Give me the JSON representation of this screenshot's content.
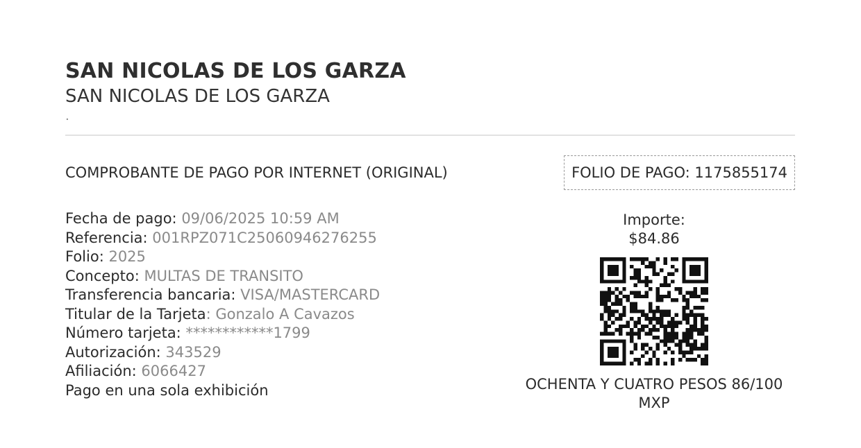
{
  "header": {
    "title": "SAN NICOLAS DE LOS GARZA",
    "subtitle": "SAN NICOLAS DE LOS GARZA",
    "dot": "."
  },
  "receipt": {
    "title": "COMPROBANTE DE PAGO POR INTERNET (ORIGINAL)",
    "folio_label": "FOLIO DE PAGO: ",
    "folio_value": "1175855174"
  },
  "details": [
    {
      "label": "Fecha de pago: ",
      "value": "09/06/2025 10:59 AM"
    },
    {
      "label": "Referencia: ",
      "value": "001RPZ071C25060946276255"
    },
    {
      "label": "Folio: ",
      "value": "2025"
    },
    {
      "label": "Concepto: ",
      "value": "MULTAS DE TRANSITO"
    },
    {
      "label": "Transferencia bancaria: ",
      "value": "VISA/MASTERCARD"
    },
    {
      "label": "Titular de la Tarjeta",
      "value": ": Gonzalo A Cavazos"
    },
    {
      "label": "Número tarjeta: ",
      "value": "************1799"
    },
    {
      "label": "Autorización: ",
      "value": "343529"
    },
    {
      "label": "Afiliación: ",
      "value": "6066427"
    },
    {
      "label": "Pago en una sola exhibición",
      "value": ""
    }
  ],
  "amount": {
    "label": "Importe:",
    "value": "$84.86",
    "words_line1": "OCHENTA Y CUATRO PESOS 86/100",
    "words_line2": "MXP"
  },
  "colors": {
    "text": "#2b2b2b",
    "value": "#8a8a8a",
    "divider": "#e2e2e2"
  },
  "icons": {
    "qr": "qr-code-icon"
  }
}
